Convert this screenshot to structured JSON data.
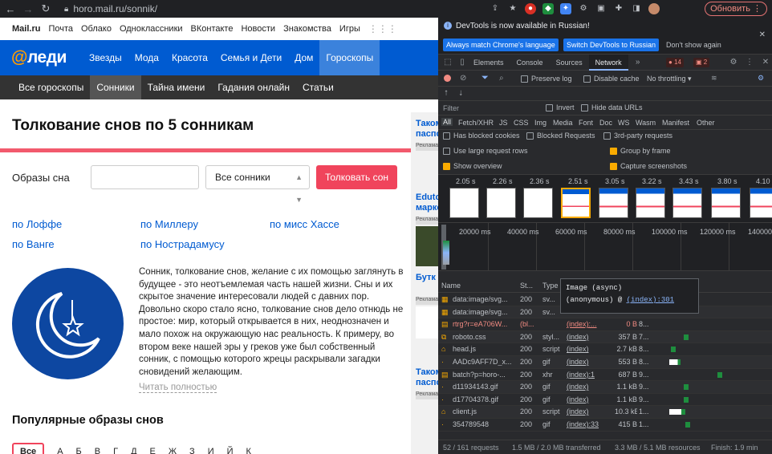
{
  "browser": {
    "url": "horo.mail.ru/sonnik/",
    "update_label": "Обновить"
  },
  "topnav": [
    "Mail.ru",
    "Почта",
    "Облако",
    "Одноклассники",
    "ВКонтакте",
    "Новости",
    "Знакомства",
    "Игры"
  ],
  "logo": {
    "at": "@",
    "text": "леди"
  },
  "mainnav": [
    "Звезды",
    "Мода",
    "Красота",
    "Семья и Дети",
    "Дом",
    "Гороскопы"
  ],
  "subnav": [
    "Все гороскопы",
    "Сонники",
    "Тайна имени",
    "Гадания онлайн",
    "Статьи"
  ],
  "headline": "Толкование снов по 5 сонникам",
  "search": {
    "label": "Образы сна",
    "select": "Все сонники",
    "button": "Толковать сон"
  },
  "dream_books": [
    "по Лоффе",
    "по Миллеру",
    "по мисс Хассе",
    "по Ванге",
    "по Нострадамусу"
  ],
  "description": "Сонник, толкование снов, желание с их помощью заглянуть в будущее - это неотъемлемая часть нашей жизни. Сны и их скрытое значение интересовали людей с давних пор. Довольно скоро стало ясно, толкование снов дело отнюдь не простое: мир, который открывается в них, неоднозначен и мало похож на окружающую нас реальность. К примеру, во втором веке нашей эры у греков уже был собственный сонник, с помощью которого жрецы раскрывали загадки сновидений желающим.",
  "read_more": "Читать полностью",
  "popular": "Популярные образы снов",
  "letters": [
    "Все",
    "А",
    "Б",
    "В",
    "Г",
    "Д",
    "Е",
    "Ж",
    "З",
    "И",
    "Й",
    "К"
  ],
  "ads": [
    {
      "title": "Таком паспор",
      "tag": "Реклама"
    },
    {
      "title": "Edutor марке",
      "tag": "Реклама"
    },
    {
      "title": "Бутк на Хе",
      "tag": "Реклама"
    },
    {
      "title": "Таком паспор",
      "tag": "Реклама"
    }
  ],
  "devtools": {
    "info": "DevTools is now available in Russian!",
    "info_buttons": [
      "Always match Chrome's language",
      "Switch DevTools to Russian",
      "Don't show again"
    ],
    "tabs": [
      "Elements",
      "Console",
      "Sources",
      "Network"
    ],
    "errors": "14",
    "warnings": "2",
    "toolbar": {
      "preserve": "Preserve log",
      "disable_cache": "Disable cache",
      "throttle": "No throttling"
    },
    "filter_placeholder": "Filter",
    "invert": "Invert",
    "hide_data": "Hide data URLs",
    "types": [
      "All",
      "Fetch/XHR",
      "JS",
      "CSS",
      "Img",
      "Media",
      "Font",
      "Doc",
      "WS",
      "Wasm",
      "Manifest",
      "Other"
    ],
    "opts": {
      "blocked_cookies": "Has blocked cookies",
      "blocked_requests": "Blocked Requests",
      "third_party": "3rd-party requests",
      "large_rows": "Use large request rows",
      "group_frame": "Group by frame",
      "overview": "Show overview",
      "screenshots": "Capture screenshots"
    },
    "film_times": [
      "2.05 s",
      "2.26 s",
      "2.36 s",
      "2.51 s",
      "3.05 s",
      "3.22 s",
      "3.43 s",
      "3.80 s",
      "4.10 s"
    ],
    "tl_marks": [
      "20000 ms",
      "40000 ms",
      "60000 ms",
      "80000 ms",
      "100000 ms",
      "120000 ms",
      "140000 ms"
    ],
    "columns": {
      "name": "Name",
      "status": "St...",
      "type": "Type"
    },
    "requests": [
      {
        "name": "data:image/svg...",
        "status": "200",
        "type": "sv...",
        "init": "",
        "size": "",
        "time": ""
      },
      {
        "name": "data:image/svg...",
        "status": "200",
        "type": "sv...",
        "init": "",
        "size": "",
        "time": ""
      },
      {
        "name": "rtrg?r=eA706W...",
        "status": "(bl...",
        "type": "",
        "init": "(index):...",
        "size": "0 B",
        "time": "8..."
      },
      {
        "name": "roboto.css",
        "status": "200",
        "type": "styl...",
        "init": "(index)",
        "size": "357 B",
        "time": "7..."
      },
      {
        "name": "head.js",
        "status": "200",
        "type": "script",
        "init": "(index)",
        "size": "2.7 kB",
        "time": "8..."
      },
      {
        "name": "AADc9AFF7D_x...",
        "status": "200",
        "type": "gif",
        "init": "(index)",
        "size": "553 B",
        "time": "8..."
      },
      {
        "name": "batch?p=horo-...",
        "status": "200",
        "type": "xhr",
        "init": "(index):1",
        "size": "687 B",
        "time": "9..."
      },
      {
        "name": "d11934143.gif",
        "status": "200",
        "type": "gif",
        "init": "(index)",
        "size": "1.1 kB",
        "time": "9..."
      },
      {
        "name": "d17704378.gif",
        "status": "200",
        "type": "gif",
        "init": "(index)",
        "size": "1.1 kB",
        "time": "9..."
      },
      {
        "name": "client.js",
        "status": "200",
        "type": "script",
        "init": "(index)",
        "size": "10.3 kB",
        "time": "1..."
      },
      {
        "name": "354789548",
        "status": "200",
        "type": "gif",
        "init": "(index):33",
        "size": "415 B",
        "time": "1..."
      }
    ],
    "tooltip": {
      "line1": "Image (async)",
      "line2": "(anonymous)",
      "at": "@",
      "link": "(index):301"
    },
    "status": {
      "requests": "52 / 161 requests",
      "transferred": "1.5 MB / 2.0 MB transferred",
      "resources": "3.3 MB / 5.1 MB resources",
      "finish": "Finish: 1.9 min"
    }
  }
}
